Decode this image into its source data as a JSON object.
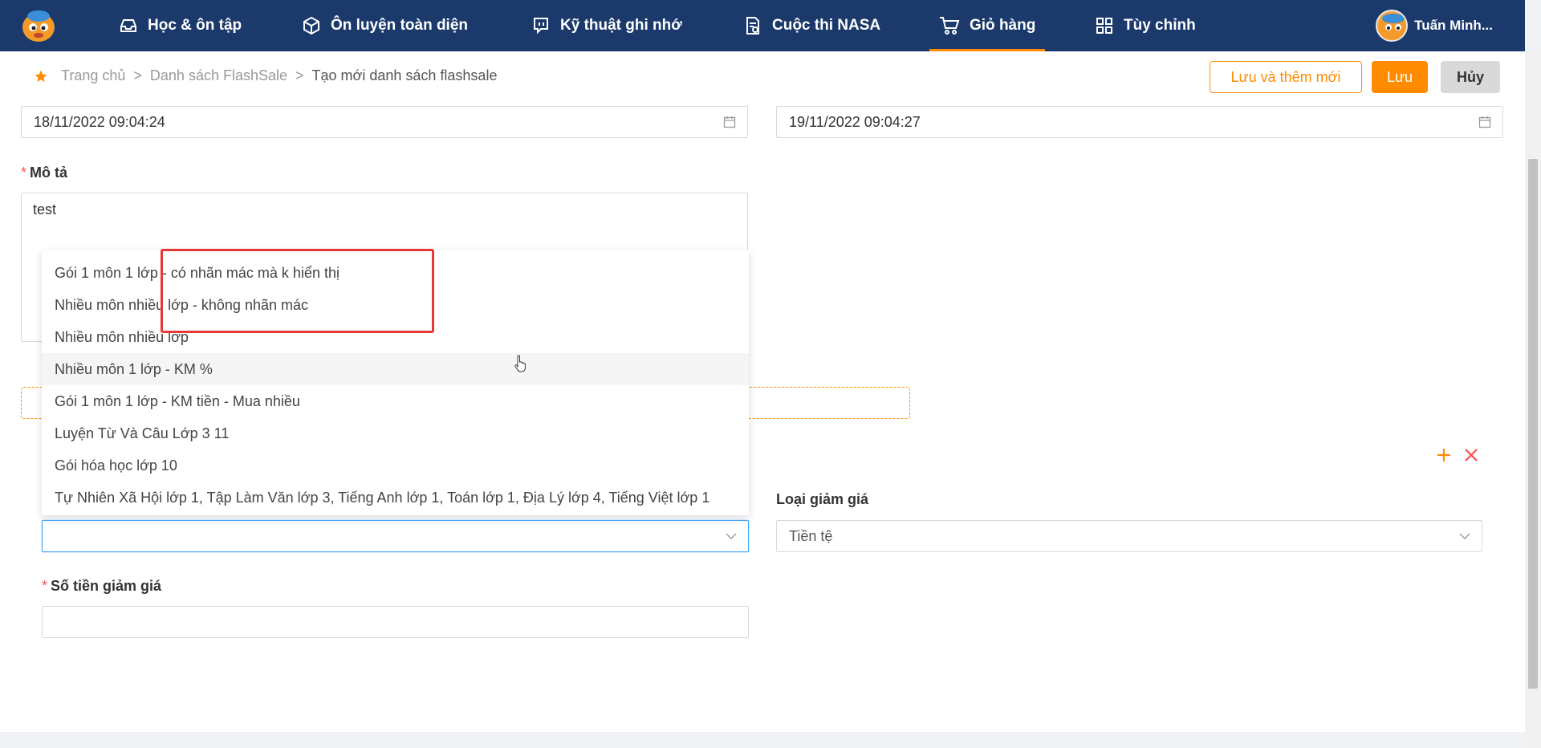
{
  "nav": {
    "items": [
      {
        "label": "Học & ôn tập",
        "icon": "inbox-icon"
      },
      {
        "label": "Ôn luyện toàn diện",
        "icon": "cube-icon"
      },
      {
        "label": "Kỹ thuật ghi nhớ",
        "icon": "chat-icon"
      },
      {
        "label": "Cuộc thi NASA",
        "icon": "document-icon"
      },
      {
        "label": "Giỏ hàng",
        "icon": "cart-icon",
        "active": true
      },
      {
        "label": "Tùy chỉnh",
        "icon": "grid-icon"
      }
    ],
    "user_name": "Tuấn Minh..."
  },
  "breadcrumb": {
    "home": "Trang chủ",
    "list": "Danh sách FlashSale",
    "current": "Tạo mới danh sách flashsale",
    "separator": ">"
  },
  "toolbar": {
    "save_add_label": "Lưu và thêm mới",
    "save_label": "Lưu",
    "cancel_label": "Hủy"
  },
  "form": {
    "start_date": "18/11/2022 09:04:24",
    "end_date": "19/11/2022 09:04:27",
    "description_label": "Mô tả",
    "description_value": "test",
    "package_select_value": "",
    "discount_type_label": "Loại giảm giá",
    "discount_type_value": "Tiền tệ",
    "discount_amount_label": "Số tiền giảm giá",
    "discount_amount_value": ""
  },
  "dropdown": {
    "options": [
      "Gói 1 môn 1 lớp - có nhãn mác mà k hiển thị",
      "Nhiều môn nhiều lớp - không nhãn mác",
      "Nhiều môn nhiều lớp",
      "Nhiều môn 1 lớp - KM %",
      "Gói 1 môn 1 lớp - KM tiền - Mua nhiều",
      "Luyện Từ Và Câu Lớp 3 11",
      "Gói hóa học lớp 10",
      "Tự Nhiên Xã Hội lớp 1, Tập Làm Văn lớp 3, Tiếng Anh lớp 1, Toán lớp 1, Địa Lý lớp 4, Tiếng Việt lớp 1"
    ],
    "hovered_index": 3
  },
  "colors": {
    "nav_bg": "#1b3a6b",
    "accent": "#ff8c00",
    "danger": "#ff4d4f",
    "highlight": "#e53935"
  }
}
